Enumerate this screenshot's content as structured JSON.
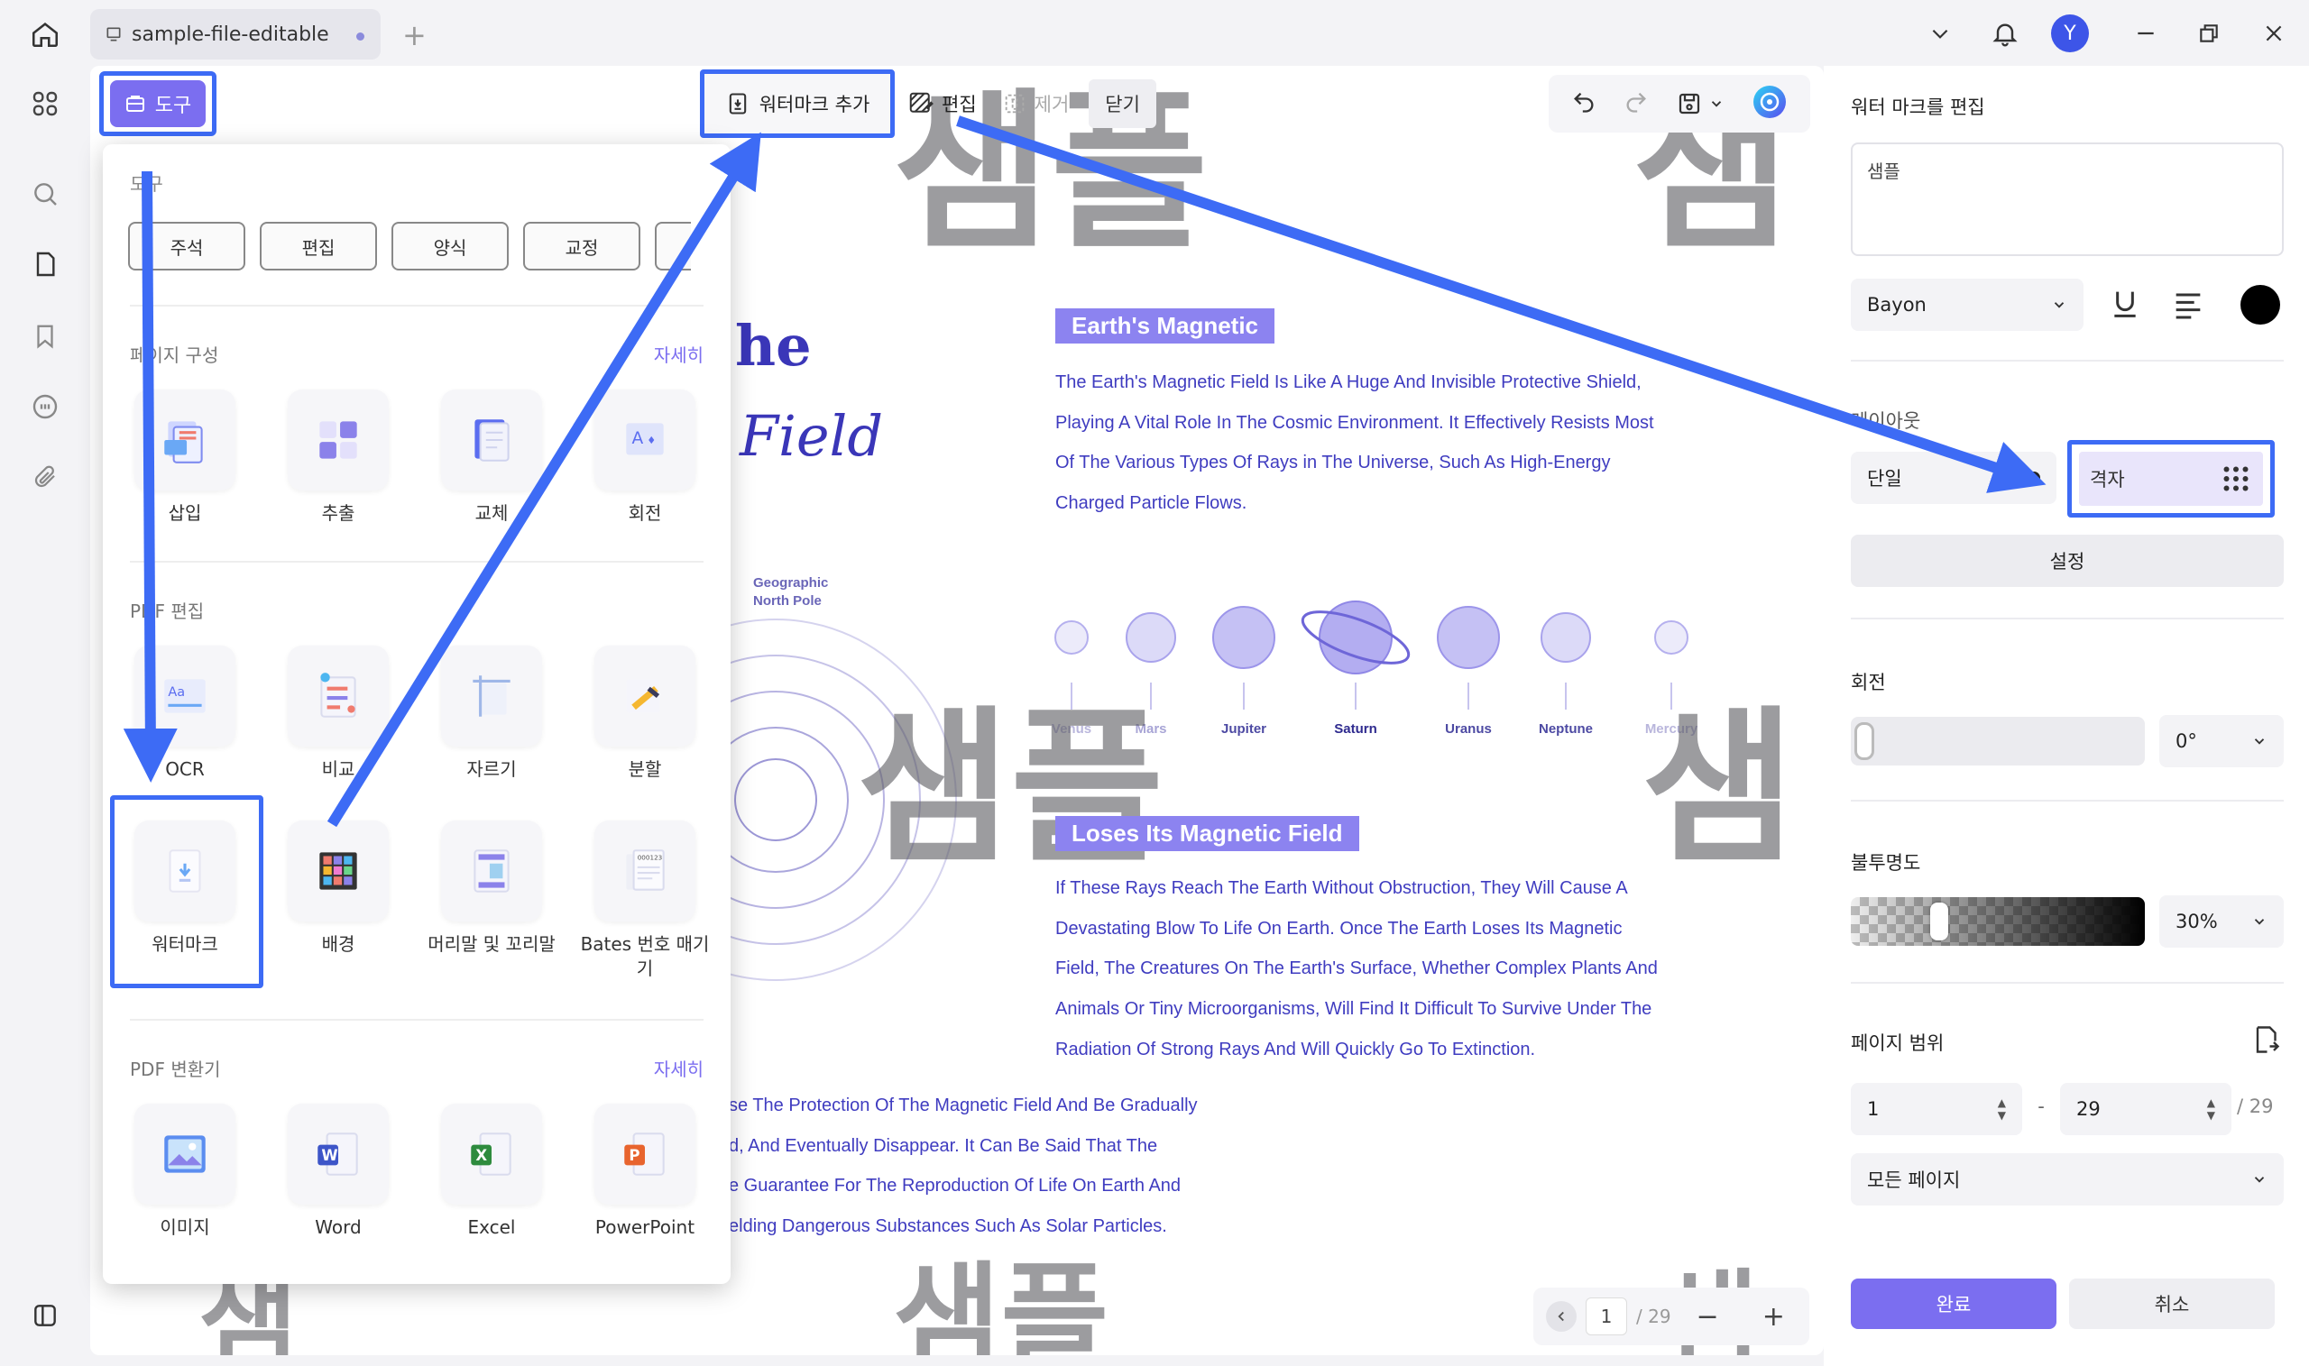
{
  "tab": {
    "title": "sample-file-editable"
  },
  "user": {
    "avatar_letter": "Y"
  },
  "toolbar": {
    "tools_label": "도구",
    "add_watermark": "워터마크 추가",
    "edit": "편집",
    "remove": "제거",
    "close": "닫기"
  },
  "tools_panel": {
    "heading": "도구",
    "chips": [
      "주석",
      "편집",
      "양식",
      "교정"
    ],
    "page_section": {
      "title": "페이지 구성",
      "more": "자세히",
      "items": [
        "삽입",
        "추출",
        "교체",
        "회전"
      ]
    },
    "pdf_edit_section": {
      "title": "PDF 편집",
      "items": [
        "OCR",
        "비교",
        "자르기",
        "분할",
        "워터마크",
        "배경",
        "머리말 및 꼬리말",
        "Bates 번호 매기기"
      ]
    },
    "converter_section": {
      "title": "PDF 변환기",
      "more": "자세히",
      "items": [
        "이미지",
        "Word",
        "Excel",
        "PowerPoint"
      ]
    }
  },
  "document": {
    "title_line1": "he",
    "title_line2": "Field",
    "badge1": "Earth's Magnetic",
    "para1": [
      "The Earth's Magnetic Field Is Like A Huge And Invisible Protective Shield,",
      "Playing A Vital Role In The Cosmic Environment. It Effectively Resists Most",
      "Of The Various Types Of Rays in The Universe, Such As High-Energy",
      "Charged Particle Flows."
    ],
    "geo_label_1": "Geographic",
    "geo_label_2": "North Pole",
    "planets": [
      "Venus",
      "Mars",
      "Jupiter",
      "Saturn",
      "Uranus",
      "Neptune",
      "Mercury"
    ],
    "badge2": "Loses Its Magnetic Field",
    "para2": [
      "If These Rays Reach The Earth Without Obstruction, They Will Cause A",
      "Devastating Blow To Life On Earth. Once The Earth Loses Its Magnetic",
      "Field, The Creatures On The Earth's Surface, Whether Complex Plants And",
      "Animals Or Tiny Microorganisms, Will Find It Difficult To Survive Under The",
      "Radiation Of Strong Rays And Will Quickly Go To Extinction."
    ],
    "para3": [
      "se The Protection Of The Magnetic Field And Be Gradually",
      "d, And Eventually Disappear. It Can Be Said That The",
      "e Guarantee For The Reproduction Of Life On Earth And",
      "elding Dangerous Substances Such As Solar Particles."
    ],
    "watermark_text": "샘플",
    "watermark_partial": "샘"
  },
  "pager": {
    "current": "1",
    "total": "/ 29"
  },
  "right_panel": {
    "title": "워터 마크를 편집",
    "text_value": "샘플",
    "font": "Bayon",
    "color": "#000000",
    "layout_label": "레이아웃",
    "layout_single": "단일",
    "layout_grid": "격자",
    "settings": "설정",
    "rotation_label": "회전",
    "rotation_value": "0°",
    "opacity_label": "불투명도",
    "opacity_value": "30%",
    "opacity_level": 0.3,
    "page_range_label": "페이지 범위",
    "range_from": "1",
    "range_to": "29",
    "range_total": "/ 29",
    "range_sep": "-",
    "pages_option": "모든 페이지",
    "done": "완료",
    "cancel": "취소"
  }
}
